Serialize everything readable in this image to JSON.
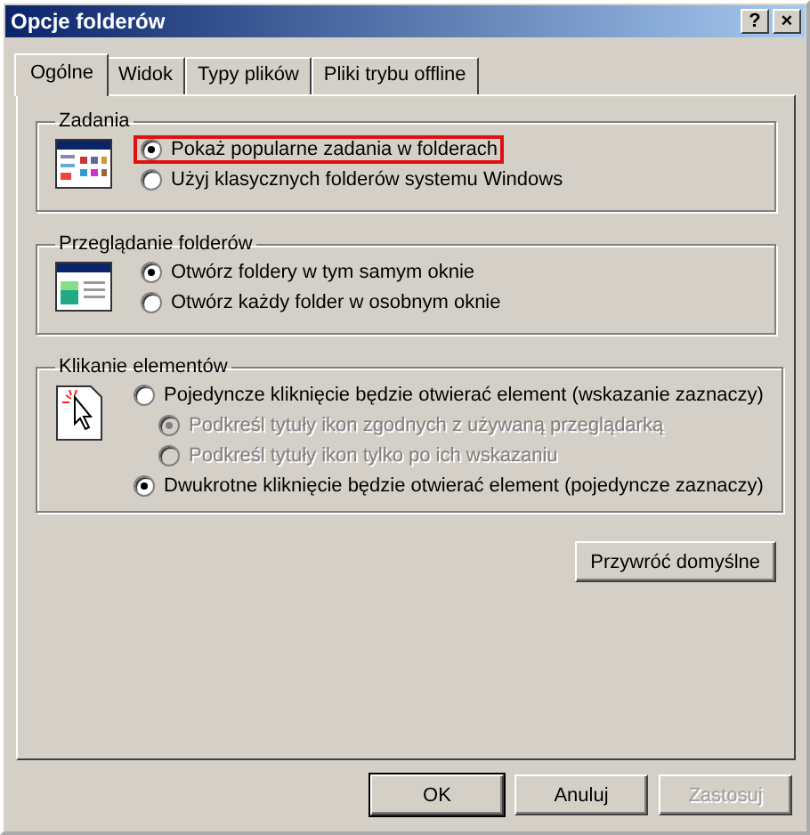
{
  "window": {
    "title": "Opcje folderów",
    "help_button": "?",
    "close_button": "×"
  },
  "tabs": [
    {
      "label": "Ogólne",
      "selected": true
    },
    {
      "label": "Widok",
      "selected": false
    },
    {
      "label": "Typy plików",
      "selected": false
    },
    {
      "label": "Pliki trybu offline",
      "selected": false
    }
  ],
  "groups": [
    {
      "kind": "tasks",
      "title": "Zadania",
      "options": [
        {
          "label": "Pokaż popularne zadania w folderach",
          "selected": true,
          "disabled": false,
          "highlighted": true
        },
        {
          "label": "Użyj klasycznych folderów systemu Windows",
          "selected": false,
          "disabled": false,
          "highlighted": false
        }
      ]
    },
    {
      "kind": "browse",
      "title": "Przeglądanie folderów",
      "options": [
        {
          "label": "Otwórz foldery w tym samym oknie",
          "selected": true,
          "disabled": false,
          "highlighted": false
        },
        {
          "label": "Otwórz każdy folder w osobnym oknie",
          "selected": false,
          "disabled": false,
          "highlighted": false
        }
      ]
    },
    {
      "kind": "click",
      "title": "Klikanie elementów",
      "options": [
        {
          "label": "Pojedyncze kliknięcie będzie otwierać element (wskazanie zaznaczy)",
          "selected": false,
          "disabled": false,
          "highlighted": false,
          "children": [
            {
              "label": "Podkreśl tytuły ikon zgodnych z używaną przeglądarką",
              "selected": true,
              "disabled": true,
              "highlighted": false
            },
            {
              "label": "Podkreśl tytuły ikon tylko po ich wskazaniu",
              "selected": false,
              "disabled": true,
              "highlighted": false
            }
          ]
        },
        {
          "label": "Dwukrotne kliknięcie będzie otwierać element (pojedyncze zaznaczy)",
          "selected": true,
          "disabled": false,
          "highlighted": false
        }
      ]
    }
  ],
  "restore_button": "Przywróć domyślne",
  "buttons": [
    {
      "label": "OK",
      "disabled": false,
      "default": true
    },
    {
      "label": "Anuluj",
      "disabled": false,
      "default": false
    },
    {
      "label": "Zastosuj",
      "disabled": true,
      "default": false
    }
  ]
}
